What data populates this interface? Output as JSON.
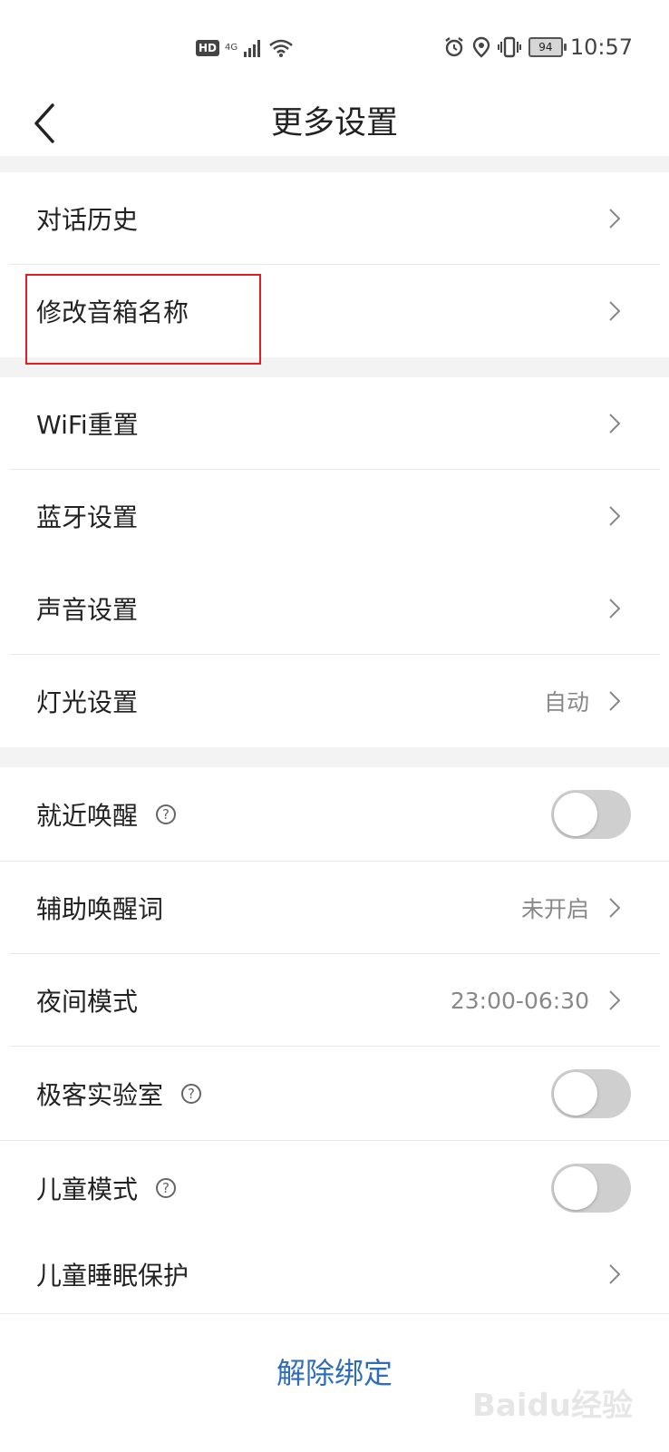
{
  "status_bar": {
    "left_badge": "HD",
    "network": "4G",
    "battery": "94",
    "time": "10:57"
  },
  "header": {
    "title": "更多设置"
  },
  "items": [
    {
      "label": "对话历史"
    },
    {
      "label": "修改音箱名称"
    },
    {
      "label": "WiFi重置"
    },
    {
      "label": "蓝牙设置"
    },
    {
      "label": "声音设置"
    },
    {
      "label": "灯光设置",
      "value": "自动"
    },
    {
      "label": "就近唤醒",
      "help": "?",
      "toggle": false
    },
    {
      "label": "辅助唤醒词",
      "value": "未开启"
    },
    {
      "label": "夜间模式",
      "value": "23:00-06:30"
    },
    {
      "label": "极客实验室",
      "help": "?",
      "toggle": false
    },
    {
      "label": "儿童模式",
      "help": "?",
      "toggle": false
    },
    {
      "label": "儿童睡眠保护"
    }
  ],
  "footer": {
    "unbind_label": "解除绑定"
  },
  "watermark": "Baidu经验",
  "colors": {
    "accent": "#2f6db8",
    "highlight": "#e02020",
    "toggle_off": "#cfcfcf"
  }
}
